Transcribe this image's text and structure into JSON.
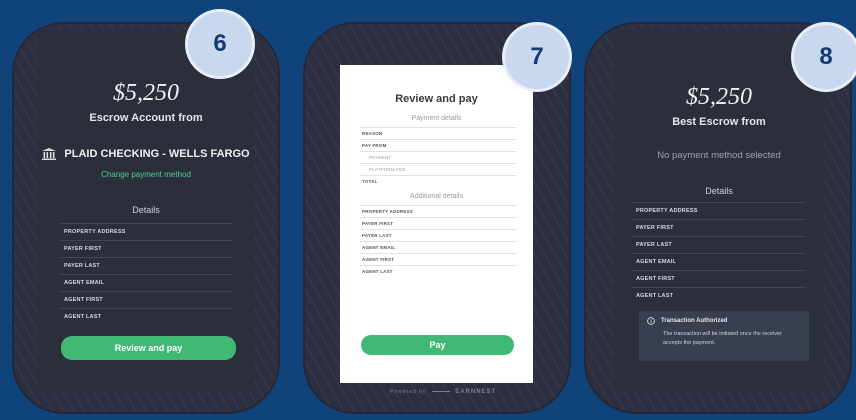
{
  "step_badges": [
    "6",
    "7",
    "8"
  ],
  "screen1": {
    "amount": "$5,250",
    "subtitle": "Escrow Account from",
    "bank_name": "PLAID CHECKING - WELLS FARGO",
    "change_link": "Change payment method",
    "details_title": "Details",
    "fields": [
      "PROPERTY ADDRESS",
      "PAYER FIRST",
      "PAYER LAST",
      "AGENT EMAIL",
      "AGENT FIRST",
      "AGENT LAST"
    ],
    "button_label": "Review and pay"
  },
  "screen2": {
    "title": "Review and pay",
    "payment_section": "Payment details",
    "payment_fields": [
      "REASON",
      "PAY FROM",
      "PAYMENT",
      "PLATFORM FEE",
      "TOTAL"
    ],
    "additional_section": "Additional details",
    "additional_fields": [
      "PROPERTY ADDRESS",
      "PAYER FIRST",
      "PAYER LAST",
      "AGENT EMAIL",
      "AGENT FIRST",
      "AGENT LAST"
    ],
    "button_label": "Pay",
    "powered_by": "Powered by",
    "brand": "EARNNEST"
  },
  "screen3": {
    "amount": "$5,250",
    "subtitle": "Best Escrow from",
    "no_method": "No payment method selected",
    "details_title": "Details",
    "fields": [
      "PROPERTY ADDRESS",
      "PAYER FIRST",
      "PAYER LAST",
      "AGENT EMAIL",
      "AGENT FIRST",
      "AGENT LAST"
    ],
    "notice_title": "Transaction Authorized",
    "notice_body": "The transaction will be initiated once the receiver accepts the payment."
  },
  "colors": {
    "background": "#10437a",
    "accent_green": "#41b874",
    "badge": "#c9d8ee"
  }
}
